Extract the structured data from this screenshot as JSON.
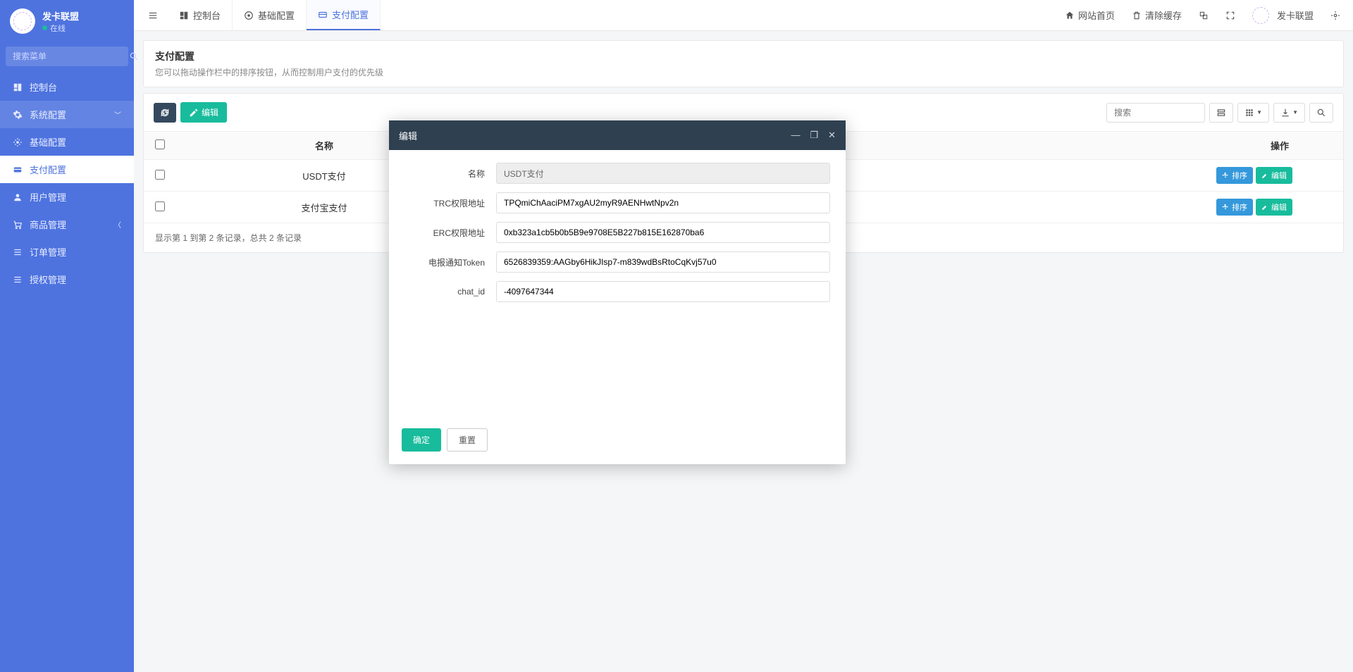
{
  "sidebar": {
    "brand": "发卡联盟",
    "status": "在线",
    "search_placeholder": "搜索菜单",
    "items": [
      {
        "icon": "dashboard",
        "label": "控制台"
      },
      {
        "icon": "gear",
        "label": "系统配置",
        "expandable": true
      },
      {
        "icon": "gear",
        "label": "基础配置",
        "sub": true
      },
      {
        "icon": "wallet",
        "label": "支付配置",
        "sub": true,
        "active": true
      },
      {
        "icon": "user",
        "label": "用户管理"
      },
      {
        "icon": "cart",
        "label": "商品管理",
        "expandable": true
      },
      {
        "icon": "list",
        "label": "订单管理"
      },
      {
        "icon": "list",
        "label": "授权管理"
      }
    ]
  },
  "topbar": {
    "tabs": [
      {
        "icon": "dashboard",
        "label": "控制台"
      },
      {
        "icon": "gear",
        "label": "基础配置"
      },
      {
        "icon": "wallet",
        "label": "支付配置",
        "active": true
      }
    ],
    "right": {
      "home": "网站首页",
      "clear_cache": "清除缓存",
      "user": "发卡联盟"
    }
  },
  "page": {
    "title": "支付配置",
    "subtitle": "您可以拖动操作栏中的排序按钮，从而控制用户支付的优先级"
  },
  "toolbar": {
    "edit": "编辑",
    "search_placeholder": "搜索"
  },
  "table": {
    "cols": {
      "name": "名称",
      "actions": "操作"
    },
    "rows": [
      {
        "name": "USDT支付"
      },
      {
        "name": "支付宝支付"
      }
    ],
    "actions": {
      "sort": "排序",
      "edit": "编辑"
    },
    "footer": "显示第 1 到第 2 条记录，总共 2 条记录"
  },
  "modal": {
    "title": "编辑",
    "fields": {
      "name": {
        "label": "名称",
        "value": "USDT支付"
      },
      "trc": {
        "label": "TRC权限地址",
        "value": "TPQmiChAaciPM7xgAU2myR9AENHwtNpv2n"
      },
      "erc": {
        "label": "ERC权限地址",
        "value": "0xb323a1cb5b0b5B9e9708E5B227b815E162870ba6"
      },
      "token": {
        "label": "电报通知Token",
        "value": "6526839359:AAGby6HikJIsp7-m839wdBsRtoCqKvj57u0"
      },
      "chat": {
        "label": "chat_id",
        "value": "-4097647344"
      }
    },
    "buttons": {
      "ok": "确定",
      "reset": "重置"
    }
  }
}
